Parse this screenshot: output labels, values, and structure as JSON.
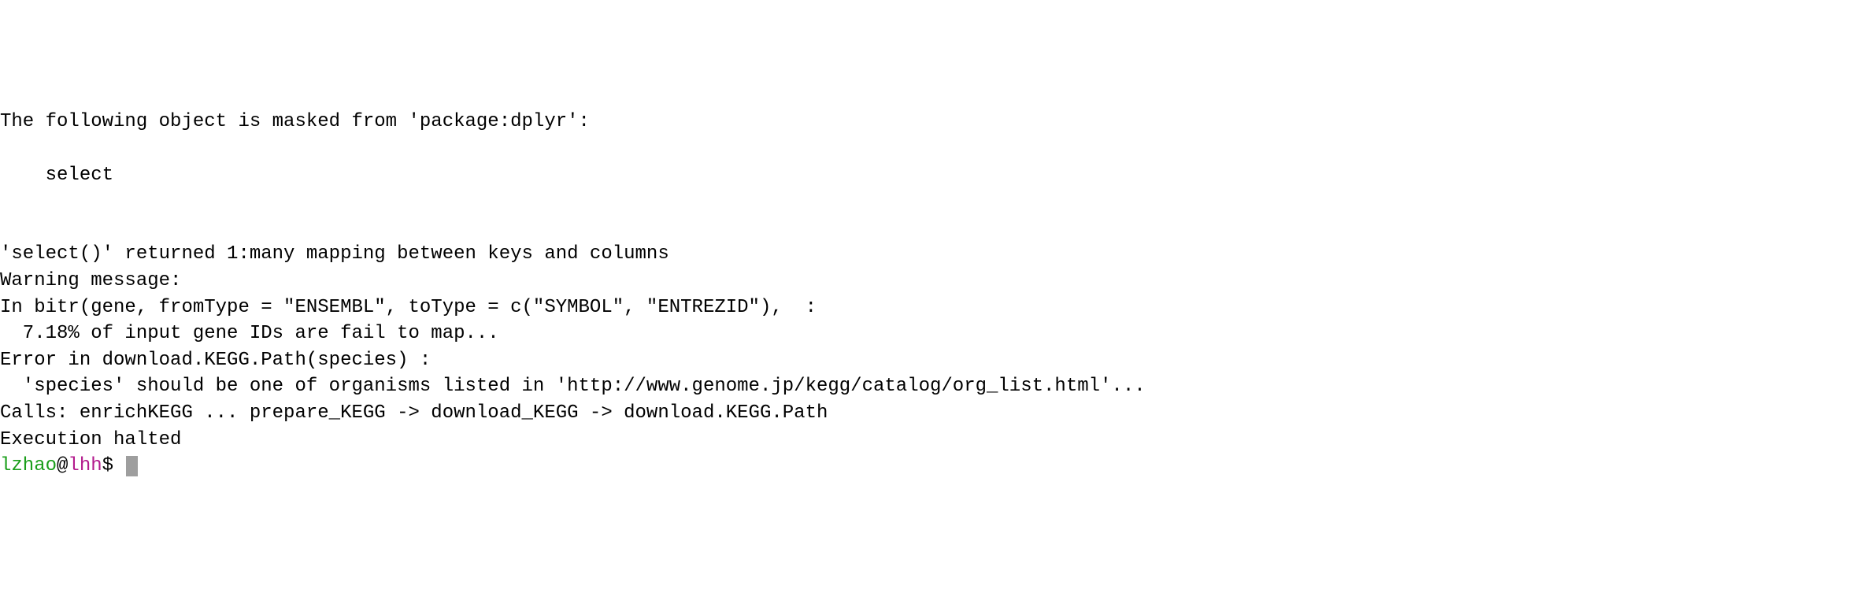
{
  "terminal": {
    "lines": [
      "The following object is masked from 'package:dplyr':",
      "",
      "    select",
      "",
      "",
      "'select()' returned 1:many mapping between keys and columns",
      "Warning message:",
      "In bitr(gene, fromType = \"ENSEMBL\", toType = c(\"SYMBOL\", \"ENTREZID\"),  :",
      "  7.18% of input gene IDs are fail to map...",
      "Error in download.KEGG.Path(species) :",
      "  'species' should be one of organisms listed in 'http://www.genome.jp/kegg/catalog/org_list.html'...",
      "Calls: enrichKEGG ... prepare_KEGG -> download_KEGG -> download.KEGG.Path",
      "Execution halted"
    ],
    "prompt": {
      "user": "lzhao",
      "at": "@",
      "host": "lhh",
      "dollar": "$"
    }
  }
}
